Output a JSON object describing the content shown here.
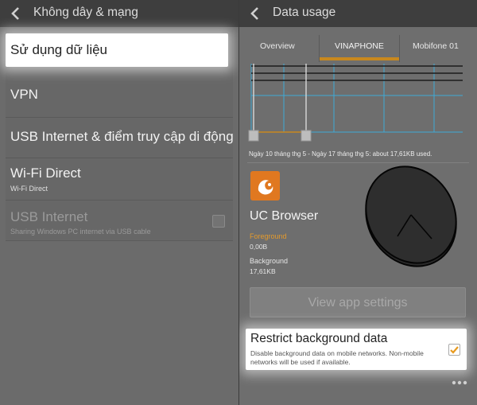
{
  "left": {
    "title": "Không dây & mạng",
    "items": [
      {
        "label": "Sử dụng dữ liệu",
        "sub": ""
      },
      {
        "label": "VPN",
        "sub": ""
      },
      {
        "label": "USB Internet & điểm truy cập di động",
        "sub": ""
      },
      {
        "label": "Wi-Fi Direct",
        "sub": "Wi-Fi Direct"
      },
      {
        "label": "USB Internet",
        "sub": "Sharing Windows PC internet via USB cable"
      }
    ]
  },
  "right": {
    "title": "Data usage",
    "tabs": [
      "Overview",
      "VINAPHONE",
      "Mobifone 01"
    ],
    "active_tab": "VINAPHONE",
    "summary": "Ngày 10 tháng thg 5 - Ngày 17 tháng thg 5: about 17,61KB used.",
    "app": {
      "name": "UC Browser",
      "foreground_label": "Foreground",
      "foreground_value": "0,00B",
      "background_label": "Background",
      "background_value": "17,61KB"
    },
    "view_button": "View app settings",
    "restrict": {
      "label": "Restrict background data",
      "desc": "Disable background data on mobile networks. Non-mobile networks will be used if available.",
      "checked": true
    }
  },
  "colors": {
    "accent": "#c8881e",
    "foreground_text": "#e49a2c",
    "app_icon": "#e07820"
  },
  "icons": [
    "back-chevron-icon",
    "uc-browser-icon",
    "checkmark-icon",
    "overflow-menu-icon"
  ]
}
